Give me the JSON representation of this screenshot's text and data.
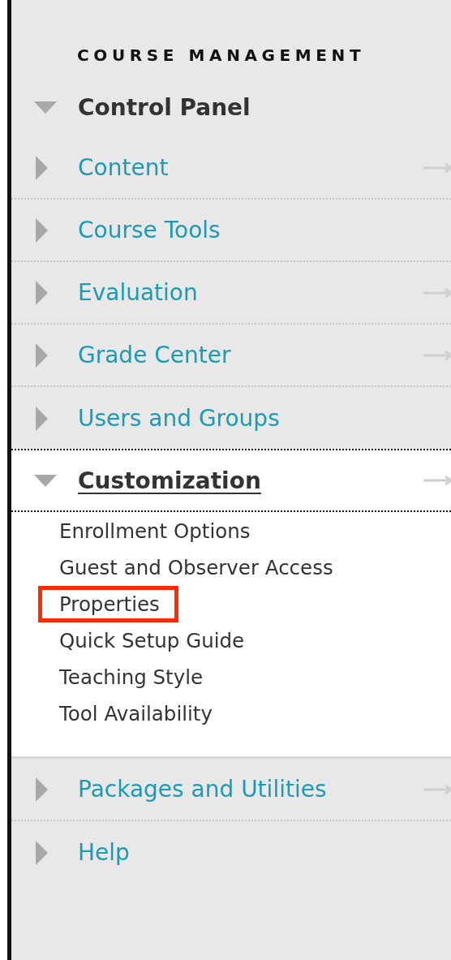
{
  "heading": "COURSE MANAGEMENT",
  "panel": {
    "title": "Control Panel",
    "expanded": true
  },
  "sections": [
    {
      "label": "Content",
      "expanded": false,
      "has_arrow": true
    },
    {
      "label": "Course Tools",
      "expanded": false,
      "has_arrow": false
    },
    {
      "label": "Evaluation",
      "expanded": false,
      "has_arrow": true
    },
    {
      "label": "Grade Center",
      "expanded": false,
      "has_arrow": true
    },
    {
      "label": "Users and Groups",
      "expanded": false,
      "has_arrow": false
    },
    {
      "label": "Customization",
      "expanded": true,
      "has_arrow": true,
      "children": [
        {
          "label": "Enrollment Options",
          "highlighted": false
        },
        {
          "label": "Guest and Observer Access",
          "highlighted": false
        },
        {
          "label": "Properties",
          "highlighted": true
        },
        {
          "label": "Quick Setup Guide",
          "highlighted": false
        },
        {
          "label": "Teaching Style",
          "highlighted": false
        },
        {
          "label": "Tool Availability",
          "highlighted": false
        }
      ]
    },
    {
      "label": "Packages and Utilities",
      "expanded": false,
      "has_arrow": true
    },
    {
      "label": "Help",
      "expanded": false,
      "has_arrow": false
    }
  ]
}
